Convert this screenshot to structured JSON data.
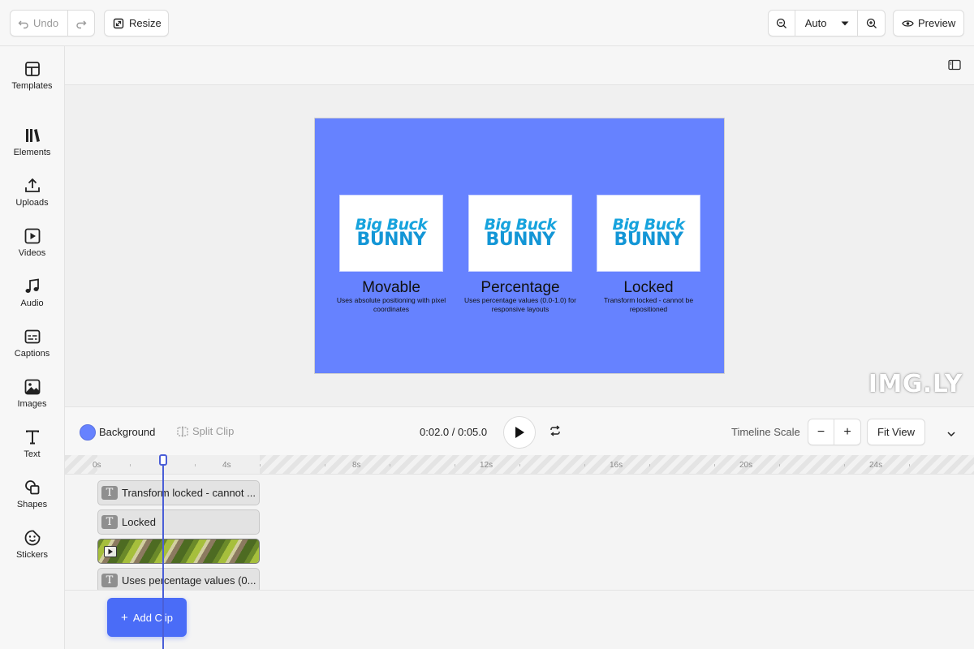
{
  "toolbar": {
    "undo_label": "Undo",
    "resize_label": "Resize",
    "zoom_value": "Auto",
    "preview_label": "Preview"
  },
  "sidebar": {
    "items": [
      {
        "label": "Templates",
        "icon": "layout-icon"
      },
      {
        "label": "Elements",
        "icon": "library-icon"
      },
      {
        "label": "Uploads",
        "icon": "upload-icon"
      },
      {
        "label": "Videos",
        "icon": "video-icon"
      },
      {
        "label": "Audio",
        "icon": "music-icon"
      },
      {
        "label": "Captions",
        "icon": "captions-icon"
      },
      {
        "label": "Images",
        "icon": "image-icon"
      },
      {
        "label": "Text",
        "icon": "text-icon"
      },
      {
        "label": "Shapes",
        "icon": "shapes-icon"
      },
      {
        "label": "Stickers",
        "icon": "sticker-icon"
      }
    ]
  },
  "canvas": {
    "background_color": "#6682ff",
    "cards": [
      {
        "logo_line1": "Big Buck",
        "logo_line2": "BUNNY",
        "title": "Movable",
        "description": "Uses absolute positioning with pixel coordinates"
      },
      {
        "logo_line1": "Big Buck",
        "logo_line2": "BUNNY",
        "title": "Percentage",
        "description": "Uses percentage values (0.0-1.0) for responsive layouts"
      },
      {
        "logo_line1": "Big Buck",
        "logo_line2": "BUNNY",
        "title": "Locked",
        "description": "Transform locked - cannot be repositioned"
      }
    ],
    "watermark": "IMG.LY"
  },
  "timeline": {
    "background_label": "Background",
    "split_clip_label": "Split Clip",
    "time_readout": "0:02.0 / 0:05.0",
    "scale_label": "Timeline Scale",
    "fit_view_label": "Fit View",
    "ruler_ticks": [
      "0s",
      "4s",
      "8s",
      "12s",
      "16s",
      "20s",
      "24s"
    ],
    "clips": [
      {
        "type": "text",
        "label": "Transform locked - cannot ..."
      },
      {
        "type": "text",
        "label": "Locked"
      },
      {
        "type": "video",
        "label": ""
      },
      {
        "type": "text",
        "label": "Uses percentage values (0..."
      }
    ],
    "add_clip_label": "Add Clip"
  }
}
